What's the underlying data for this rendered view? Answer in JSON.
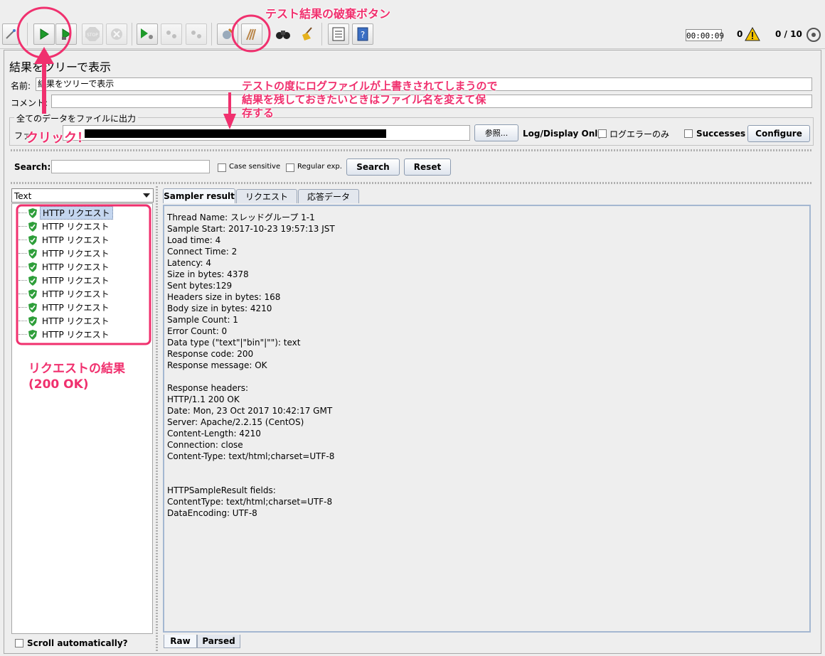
{
  "toolbar": {
    "timer": "00:00:09",
    "error_count": "0",
    "threads": "0 / 10",
    "buttons": [
      {
        "name": "wand-icon",
        "disabled": false
      },
      {
        "name": "start-icon",
        "disabled": false
      },
      {
        "name": "start-no-pause-icon",
        "disabled": false
      },
      {
        "name": "stop-icon",
        "disabled": true
      },
      {
        "name": "shutdown-icon",
        "disabled": true
      },
      {
        "name": "remote-start-icon",
        "disabled": false
      },
      {
        "name": "remote-stop-icon",
        "disabled": true
      },
      {
        "name": "remote-shutdown-icon",
        "disabled": true
      },
      {
        "name": "clear-icon",
        "disabled": false
      },
      {
        "name": "clear-all-icon",
        "disabled": false
      },
      {
        "name": "search-binoculars-icon",
        "disabled": false
      },
      {
        "name": "reset-search-broom-icon",
        "disabled": false
      },
      {
        "name": "function-helper-icon",
        "disabled": false
      },
      {
        "name": "help-icon",
        "disabled": false
      }
    ]
  },
  "panel": {
    "title": "結果をツリーで表示",
    "name_label": "名前:",
    "name_value": "結果をツリーで表示",
    "comment_label": "コメント:",
    "group_title": "全てのデータをファイルに出力",
    "file_label": "ファ",
    "browse_button": "参照...",
    "log_display_label": "Log/Display Only:",
    "errors_only_label": "ログエラーのみ",
    "successes_label": "Successes",
    "configure_button": "Configure"
  },
  "search": {
    "label": "Search:",
    "case_sensitive": "Case sensitive",
    "regular_exp": "Regular exp.",
    "search_button": "Search",
    "reset_button": "Reset"
  },
  "tree": {
    "renderer": "Text",
    "items": [
      "HTTP リクエスト",
      "HTTP リクエスト",
      "HTTP リクエスト",
      "HTTP リクエスト",
      "HTTP リクエスト",
      "HTTP リクエスト",
      "HTTP リクエスト",
      "HTTP リクエスト",
      "HTTP リクエスト",
      "HTTP リクエスト"
    ],
    "scroll_auto": "Scroll automatically?"
  },
  "tabs": [
    "Sampler result",
    "リクエスト",
    "応答データ"
  ],
  "bottom_tabs": [
    "Raw",
    "Parsed"
  ],
  "result_text": "Thread Name: スレッドグループ 1-1\nSample Start: 2017-10-23 19:57:13 JST\nLoad time: 4\nConnect Time: 2\nLatency: 4\nSize in bytes: 4378\nSent bytes:129\nHeaders size in bytes: 168\nBody size in bytes: 4210\nSample Count: 1\nError Count: 0\nData type (\"text\"|\"bin\"|\"\"): text\nResponse code: 200\nResponse message: OK\n\nResponse headers:\nHTTP/1.1 200 OK\nDate: Mon, 23 Oct 2017 10:42:17 GMT\nServer: Apache/2.2.15 (CentOS)\nContent-Length: 4210\nConnection: close\nContent-Type: text/html;charset=UTF-8\n\n\nHTTPSampleResult fields:\nContentType: text/html;charset=UTF-8\nDataEncoding: UTF-8",
  "annotations": {
    "clear_button_note": "テスト結果の破棄ボタン",
    "file_note_line1": "テストの度にログファイルが上書きされてしまうので",
    "file_note_line2": "結果を残しておきたいときはファイル名を変えて保",
    "file_note_line3": "存する",
    "click_note": "クリック！",
    "result_note_line1": "リクエストの結果",
    "result_note_line2": "(200 OK)"
  },
  "colors": {
    "annotation": "#f0306e",
    "success_icon": "#2e9e3a"
  }
}
